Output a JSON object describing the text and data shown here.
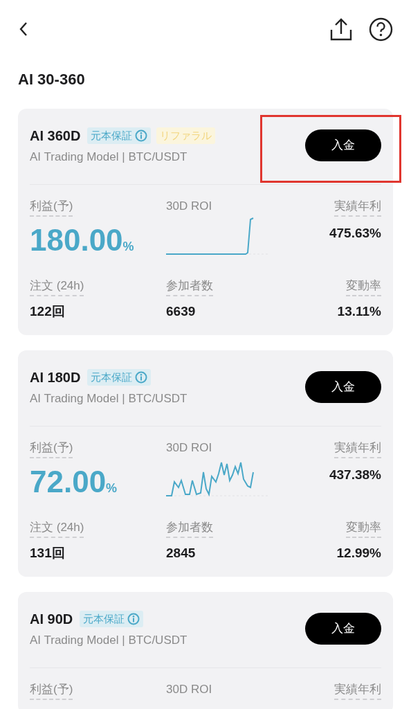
{
  "header": {
    "title": "AI 30-360"
  },
  "cards": [
    {
      "name": "AI 360D",
      "highlighted": true,
      "badges": [
        {
          "kind": "guarantee",
          "label": "元本保証"
        },
        {
          "kind": "referral",
          "label": "リファラル"
        }
      ],
      "subtitle": "AI Trading Model | BTC/USDT",
      "button": "入金",
      "profit_label": "利益(予)",
      "profit_value": "180.00",
      "profit_unit": "%",
      "roi_label": "30D ROI",
      "apr_label": "実績年利",
      "apr_value": "475.63%",
      "stats": [
        {
          "label": "注文 (24h)",
          "value": "122回"
        },
        {
          "label": "参加者数",
          "value": "6639"
        },
        {
          "label": "変動率",
          "value": "13.11%"
        }
      ]
    },
    {
      "name": "AI 180D",
      "highlighted": false,
      "badges": [
        {
          "kind": "guarantee",
          "label": "元本保証"
        }
      ],
      "subtitle": "AI Trading Model | BTC/USDT",
      "button": "入金",
      "profit_label": "利益(予)",
      "profit_value": "72.00",
      "profit_unit": "%",
      "roi_label": "30D ROI",
      "apr_label": "実績年利",
      "apr_value": "437.38%",
      "stats": [
        {
          "label": "注文 (24h)",
          "value": "131回"
        },
        {
          "label": "参加者数",
          "value": "2845"
        },
        {
          "label": "変動率",
          "value": "12.99%"
        }
      ]
    },
    {
      "name": "AI 90D",
      "highlighted": false,
      "badges": [
        {
          "kind": "guarantee",
          "label": "元本保証"
        }
      ],
      "subtitle": "AI Trading Model | BTC/USDT",
      "button": "入金",
      "profit_label": "利益(予)",
      "roi_label": "30D ROI",
      "apr_label": "実績年利"
    }
  ]
}
